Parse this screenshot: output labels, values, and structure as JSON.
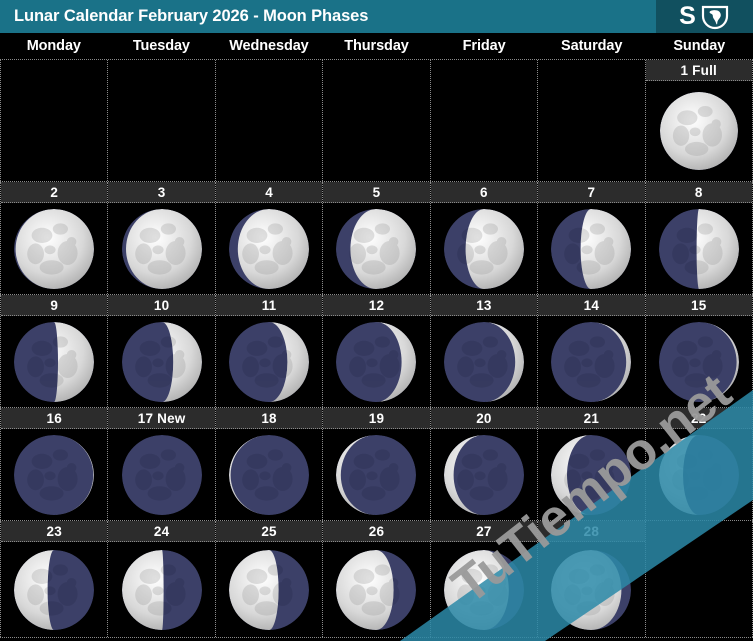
{
  "header": {
    "title": "Lunar Calendar February 2026 - Moon Phases",
    "logo_letter": "S",
    "logo_icon": "globe-icon",
    "bar_color": "#1a7288",
    "logo_bg_color": "#11505f"
  },
  "weekdays": [
    "Monday",
    "Tuesday",
    "Wednesday",
    "Thursday",
    "Friday",
    "Saturday",
    "Sunday"
  ],
  "watermark": {
    "text": "TuTiempo.net",
    "band_color": "#2b8aa8",
    "text_color": "#9a9a9a"
  },
  "colors": {
    "lit": "#d8d8d8",
    "shadow": "#3c4068",
    "daybar_bg": "#2c2c2c",
    "cell_bg": "#000000",
    "grid_line": "#8a8a8a"
  },
  "calendar": {
    "month": "February",
    "year": "2026",
    "weeks": [
      [
        {
          "day": "",
          "label": "",
          "phase": null
        },
        {
          "day": "",
          "label": "",
          "phase": null
        },
        {
          "day": "",
          "label": "",
          "phase": null
        },
        {
          "day": "",
          "label": "",
          "phase": null
        },
        {
          "day": "",
          "label": "",
          "phase": null
        },
        {
          "day": "",
          "label": "",
          "phase": null
        },
        {
          "day": "1",
          "label": "1 Full",
          "phase": 1.0,
          "phase_name": "Full Moon"
        }
      ],
      [
        {
          "day": "2",
          "label": "2",
          "phase": 0.98,
          "phase_name": "Waning Gibbous"
        },
        {
          "day": "3",
          "label": "3",
          "phase": 0.95,
          "phase_name": "Waning Gibbous"
        },
        {
          "day": "4",
          "label": "4",
          "phase": 0.89,
          "phase_name": "Waning Gibbous"
        },
        {
          "day": "5",
          "label": "5",
          "phase": 0.82,
          "phase_name": "Waning Gibbous"
        },
        {
          "day": "6",
          "label": "6",
          "phase": 0.73,
          "phase_name": "Waning Gibbous"
        },
        {
          "day": "7",
          "label": "7",
          "phase": 0.63,
          "phase_name": "Waning Gibbous"
        },
        {
          "day": "8",
          "label": "8",
          "phase": 0.53,
          "phase_name": "Last Quarter"
        }
      ],
      [
        {
          "day": "9",
          "label": "9",
          "phase": 0.45,
          "phase_name": "Last Quarter"
        },
        {
          "day": "10",
          "label": "10",
          "phase": 0.36,
          "phase_name": "Waning Crescent"
        },
        {
          "day": "11",
          "label": "11",
          "phase": 0.27,
          "phase_name": "Waning Crescent"
        },
        {
          "day": "12",
          "label": "12",
          "phase": 0.18,
          "phase_name": "Waning Crescent"
        },
        {
          "day": "13",
          "label": "13",
          "phase": 0.11,
          "phase_name": "Waning Crescent"
        },
        {
          "day": "14",
          "label": "14",
          "phase": 0.06,
          "phase_name": "Waning Crescent"
        },
        {
          "day": "15",
          "label": "15",
          "phase": 0.03,
          "phase_name": "Waning Crescent"
        }
      ],
      [
        {
          "day": "16",
          "label": "16",
          "phase": 0.01,
          "phase_name": "Waning Crescent"
        },
        {
          "day": "17",
          "label": "17 New",
          "phase": 0.0,
          "phase_name": "New Moon"
        },
        {
          "day": "18",
          "label": "18",
          "phase": -0.02,
          "phase_name": "Waxing Crescent"
        },
        {
          "day": "19",
          "label": "19",
          "phase": -0.06,
          "phase_name": "Waxing Crescent"
        },
        {
          "day": "20",
          "label": "20",
          "phase": -0.12,
          "phase_name": "Waxing Crescent"
        },
        {
          "day": "21",
          "label": "21",
          "phase": -0.2,
          "phase_name": "Waxing Crescent"
        },
        {
          "day": "22",
          "label": "22",
          "phase": -0.3,
          "phase_name": "Waxing Crescent"
        }
      ],
      [
        {
          "day": "23",
          "label": "23",
          "phase": -0.42,
          "phase_name": "First Quarter"
        },
        {
          "day": "24",
          "label": "24",
          "phase": -0.52,
          "phase_name": "First Quarter"
        },
        {
          "day": "25",
          "label": "25",
          "phase": -0.62,
          "phase_name": "Waxing Gibbous"
        },
        {
          "day": "26",
          "label": "26",
          "phase": -0.72,
          "phase_name": "Waxing Gibbous"
        },
        {
          "day": "27",
          "label": "27",
          "phase": -0.81,
          "phase_name": "Waxing Gibbous"
        },
        {
          "day": "28",
          "label": "28",
          "phase": -0.88,
          "phase_name": "Waxing Gibbous"
        },
        {
          "day": "",
          "label": "",
          "phase": null
        }
      ]
    ]
  }
}
